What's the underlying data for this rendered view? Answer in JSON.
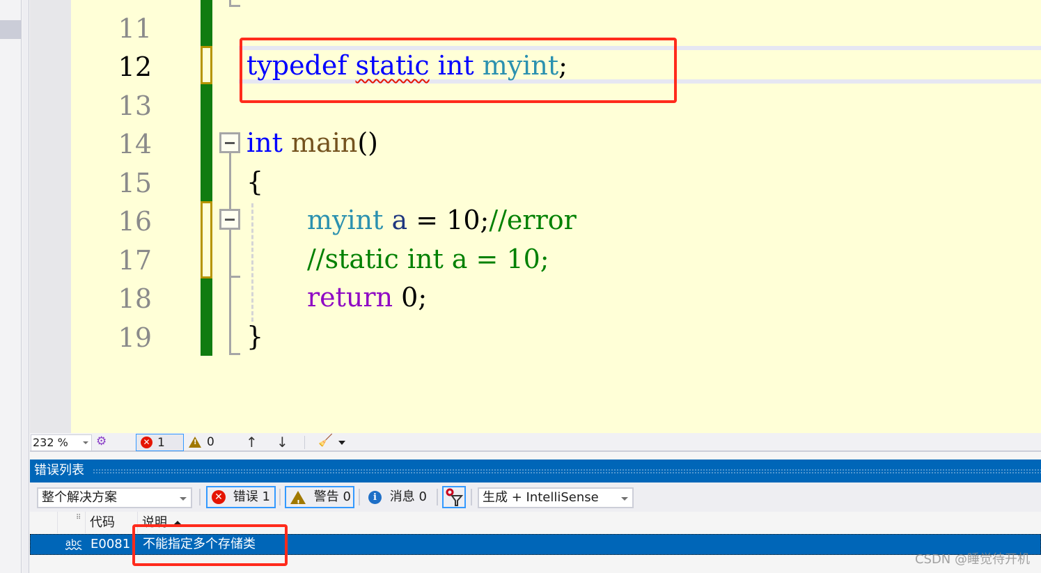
{
  "editor": {
    "zoom_level": "232 %",
    "lines": [
      {
        "number": "11",
        "current": false
      },
      {
        "number": "12",
        "current": true
      },
      {
        "number": "13",
        "current": false
      },
      {
        "number": "14",
        "current": false
      },
      {
        "number": "15",
        "current": false
      },
      {
        "number": "16",
        "current": false
      },
      {
        "number": "17",
        "current": false
      },
      {
        "number": "18",
        "current": false
      },
      {
        "number": "19",
        "current": false
      }
    ],
    "code": {
      "line12": {
        "kw_typedef": "typedef",
        "kw_static": "static",
        "kw_int": "int",
        "type_myint": "myint",
        "semicolon": ";"
      },
      "line14": {
        "kw_int": "int",
        "fn_main": "main",
        "parens": "()"
      },
      "line15": {
        "brace_open": "{"
      },
      "line16": {
        "type_myint": "myint",
        "var_a": "a",
        "op": " = ",
        "num": "10",
        "semicolon": ";",
        "comment": "//error"
      },
      "line17": {
        "comment": "//static int a = 10;"
      },
      "line18": {
        "kw_return": "return",
        "num": "0",
        "semicolon": ";"
      },
      "line19": {
        "brace_close": "}"
      }
    },
    "status": {
      "error_count": "1",
      "warning_count": "0",
      "up_arrow": "↑",
      "down_arrow": "↓"
    }
  },
  "error_list": {
    "title": "错误列表",
    "scope": "整个解决方案",
    "errors_label": "错误 1",
    "warnings_label": "警告 0",
    "messages_label": "消息 0",
    "build_source": "生成 + IntelliSense",
    "columns": {
      "code": "代码",
      "description": "说明"
    },
    "rows": [
      {
        "code": "E0081",
        "description": "不能指定多个存储类",
        "icon": "abc"
      }
    ]
  },
  "watermark": "CSDN @睡觉待开机",
  "colors": {
    "editor_bg": "#ffffd7",
    "keyword": "#0000ff",
    "type": "#2b91af",
    "comment": "#008000",
    "control_keyword": "#8f08c4",
    "function": "#74531f",
    "accent": "#0066b8",
    "highlight_box": "#ff2b1c"
  }
}
